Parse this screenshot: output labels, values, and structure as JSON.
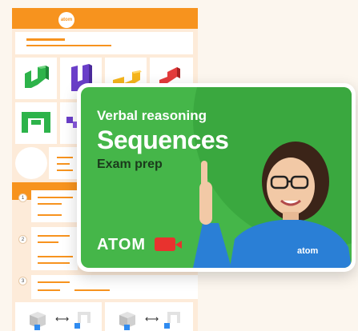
{
  "sheet": {
    "logo_text": "atom",
    "numbers": [
      "1",
      "2",
      "3"
    ],
    "arrows": [
      "⟷",
      "⟷"
    ]
  },
  "card": {
    "subtitle": "Verbal reasoning",
    "title": "Sequences",
    "tagline": "Exam prep",
    "brand": "ATOM",
    "video_icon": "video-camera-icon"
  },
  "colors": {
    "orange": "#f7931e",
    "green_bg": "#45b649",
    "shirt_blue": "#2a7fd6",
    "video_red": "#e8322e"
  }
}
